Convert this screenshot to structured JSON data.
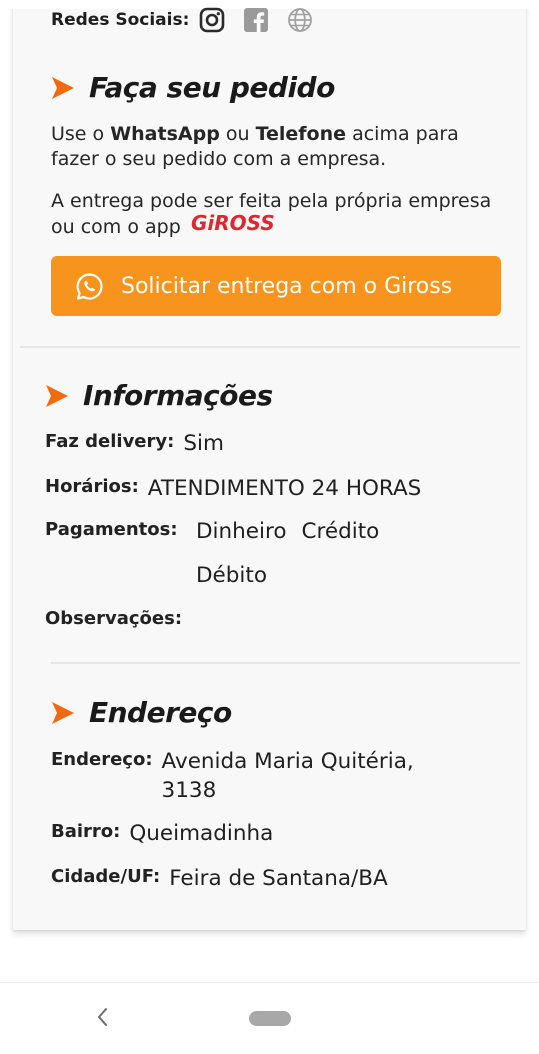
{
  "social": {
    "label": "Redes Sociais:",
    "icons": [
      "instagram-icon",
      "facebook-icon",
      "globe-icon"
    ]
  },
  "order": {
    "title": "Faça seu pedido",
    "line1_pre": "Use o ",
    "line1_whatsapp": "WhatsApp",
    "line1_mid": " ou ",
    "line1_phone": "Telefone",
    "line1_post": " acima para fazer o seu pedido com a empresa.",
    "line2": "A entrega pode ser feita pela própria empresa ou com o app",
    "logo_text": "GiROSS",
    "cta_label": "Solicitar entrega com o Giross"
  },
  "info": {
    "title": "Informações",
    "delivery_label": "Faz delivery:",
    "delivery_value": "Sim",
    "hours_label": "Horários:",
    "hours_value": "ATENDIMENTO 24 HORAS",
    "payments_label": "Pagamentos:",
    "payments": [
      "Dinheiro",
      "Crédito",
      "Débito"
    ],
    "notes_label": "Observações:"
  },
  "address": {
    "title": "Endereço",
    "street_label": "Endereço:",
    "street_value": "Avenida Maria Quitéria, 3138",
    "district_label": "Bairro:",
    "district_value": "Queimadinha",
    "city_label": "Cidade/UF:",
    "city_value": "Feira de Santana/BA"
  },
  "colors": {
    "accent": "#f7941d",
    "card_background": "#f8f8f8",
    "logo_red": "#e0262f"
  }
}
